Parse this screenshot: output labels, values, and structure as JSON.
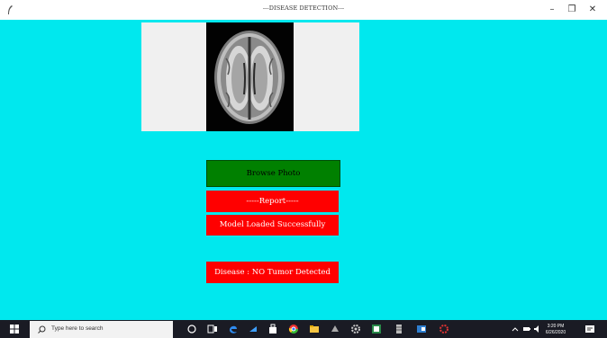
{
  "window": {
    "title": "---DISEASE DETECTION---",
    "minimize_label": "–",
    "restore_label": "❐",
    "close_label": "✕"
  },
  "main": {
    "browse_label": "Browse Photo",
    "report_label": "-----Report-----",
    "model_status": "Model Loaded Successfully",
    "disease_result": "Disease : NO Tumor Detected"
  },
  "taskbar": {
    "search_placeholder": "Type here to search",
    "time": "3:20 PM",
    "date": "6/26/2020"
  },
  "colors": {
    "background": "#00e8ee",
    "browse_button": "#008000",
    "result_box": "#ff0000"
  },
  "icons": [
    "feather-icon",
    "start-icon",
    "search-icon",
    "cortana-icon",
    "task-view-icon",
    "edge-icon",
    "app-icon",
    "store-icon",
    "chrome-icon",
    "file-explorer-icon",
    "app-icon",
    "settings-icon",
    "app-icon",
    "app-icon",
    "app-icon",
    "app-icon",
    "chevron-up-icon",
    "battery-icon",
    "volume-icon",
    "notification-icon"
  ]
}
